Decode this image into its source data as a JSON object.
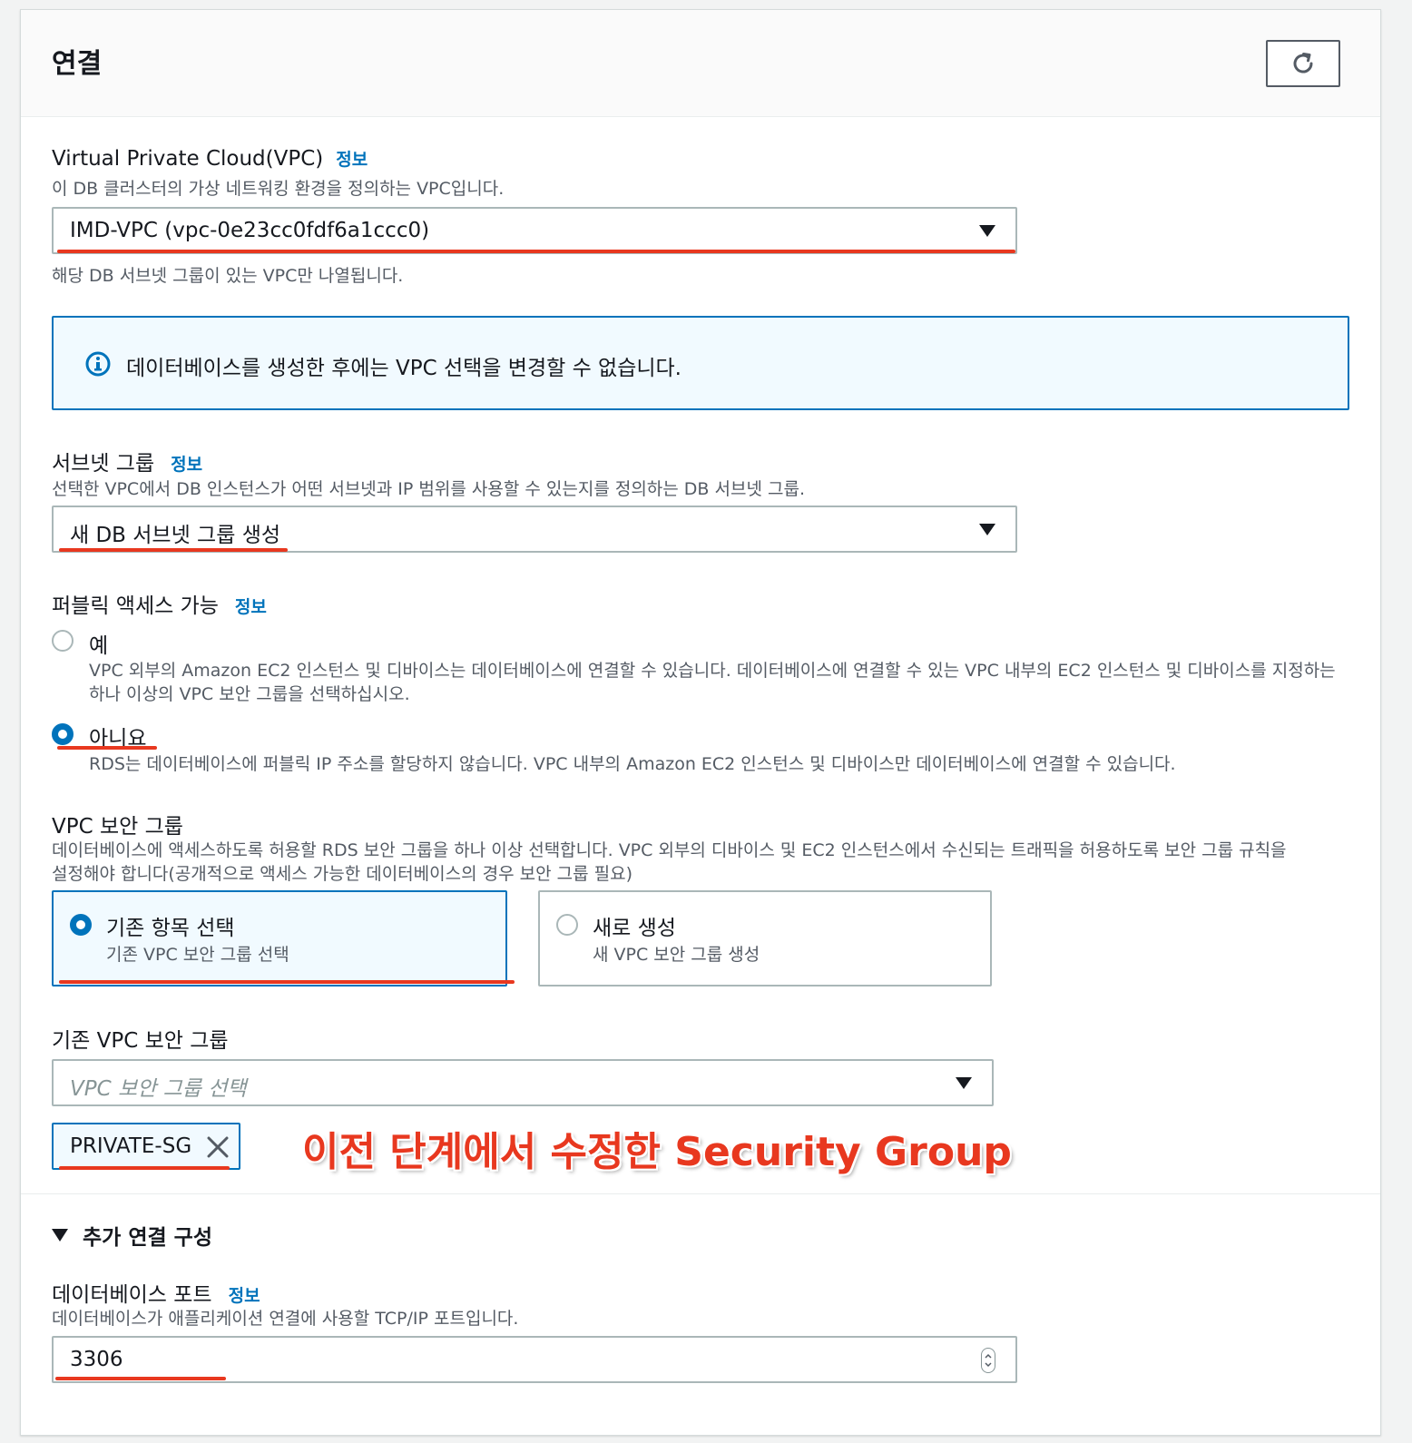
{
  "header": {
    "title": "연결"
  },
  "vpc": {
    "label": "Virtual Private Cloud(VPC)",
    "info": "정보",
    "description": "이 DB 클러스터의 가상 네트워킹 환경을 정의하는 VPC입니다.",
    "selected": "IMD-VPC (vpc-0e23cc0fdf6a1ccc0)",
    "hint": "해당 DB 서브넷 그룹이 있는 VPC만 나열됩니다."
  },
  "alert": {
    "text": "데이터베이스를 생성한 후에는 VPC 선택을 변경할 수 없습니다."
  },
  "subnet": {
    "label": "서브넷 그룹",
    "info": "정보",
    "description": "선택한 VPC에서 DB 인스턴스가 어떤 서브넷과 IP 범위를 사용할 수 있는지를 정의하는 DB 서브넷 그룹.",
    "selected": "새 DB 서브넷 그룹 생성"
  },
  "public_access": {
    "label": "퍼블릭 액세스 가능",
    "info": "정보",
    "options": [
      {
        "label": "예",
        "description_line1": "VPC 외부의 Amazon EC2 인스턴스 및 디바이스는 데이터베이스에 연결할 수 있습니다. 데이터베이스에 연결할 수 있는 VPC 내부의 EC2 인스턴스 및 디바이스를 지정하는",
        "description_line2": "하나 이상의 VPC 보안 그룹을 선택하십시오.",
        "checked": false
      },
      {
        "label": "아니요",
        "description": "RDS는 데이터베이스에 퍼블릭 IP 주소를 할당하지 않습니다. VPC 내부의 Amazon EC2 인스턴스 및 디바이스만 데이터베이스에 연결할 수 있습니다.",
        "checked": true
      }
    ]
  },
  "security_group": {
    "label": "VPC 보안 그룹",
    "description_line1": "데이터베이스에 액세스하도록 허용할 RDS 보안 그룹을 하나 이상 선택합니다. VPC 외부의 디바이스 및 EC2 인스턴스에서 수신되는 트래픽을 허용하도록 보안 그룹 규칙을",
    "description_line2": "설정해야 합니다(공개적으로 액세스 가능한 데이터베이스의 경우 보안 그룹 필요)",
    "tiles": [
      {
        "title": "기존 항목 선택",
        "subtitle": "기존 VPC 보안 그룹 선택",
        "checked": true
      },
      {
        "title": "새로 생성",
        "subtitle": "새 VPC 보안 그룹 생성",
        "checked": false
      }
    ]
  },
  "existing_sg": {
    "label": "기존 VPC 보안 그룹",
    "placeholder": "VPC 보안 그룹 선택",
    "token": "PRIVATE-SG"
  },
  "annotation": {
    "text": "이전 단계에서 수정한 Security Group"
  },
  "additional": {
    "title": "추가 연결 구성"
  },
  "port": {
    "label": "데이터베이스 포트",
    "info": "정보",
    "description": "데이터베이스가 애플리케이션 연결에 사용할 TCP/IP 포트입니다.",
    "value": "3306"
  },
  "colors": {
    "accent": "#0073bb",
    "annotation": "#e8381f",
    "border": "#aab7b8"
  }
}
